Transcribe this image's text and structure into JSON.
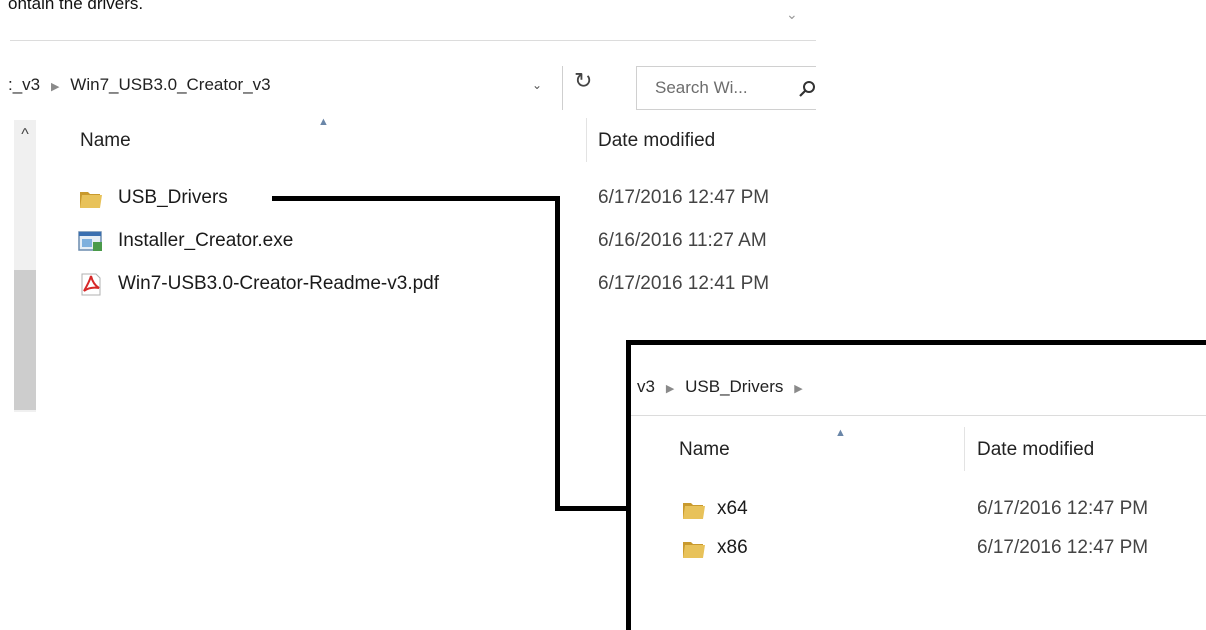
{
  "caption": "ontain the drivers.",
  "window1": {
    "address": {
      "prev_segment": ":_v3",
      "current": "Win7_USB3.0_Creator_v3"
    },
    "search": {
      "placeholder": "Search Wi..."
    },
    "columns": {
      "name": "Name",
      "date": "Date modified"
    },
    "rows": [
      {
        "name": "USB_Drivers",
        "date": "6/17/2016 12:47 PM",
        "icon": "folder-icon"
      },
      {
        "name": "Installer_Creator.exe",
        "date": "6/16/2016 11:27 AM",
        "icon": "exe-icon"
      },
      {
        "name": "Win7-USB3.0-Creator-Readme-v3.pdf",
        "date": "6/17/2016 12:41 PM",
        "icon": "pdf-icon"
      }
    ]
  },
  "window2": {
    "address": {
      "prev_segment": "v3",
      "current": "USB_Drivers"
    },
    "columns": {
      "name": "Name",
      "date": "Date modified"
    },
    "rows": [
      {
        "name": "x64",
        "date": "6/17/2016 12:47 PM",
        "icon": "folder-icon"
      },
      {
        "name": "x86",
        "date": "6/17/2016 12:47 PM",
        "icon": "folder-icon"
      }
    ]
  },
  "colors": {
    "folder": "#e8c25a",
    "folder_dark": "#c99a2e",
    "pdf": "#d62828",
    "connector": "#000000",
    "sort_arrow": "#6a86a8"
  }
}
